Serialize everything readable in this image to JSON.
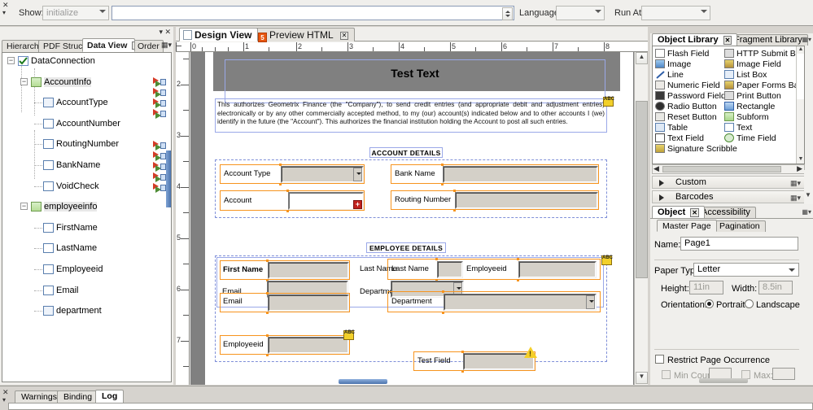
{
  "scriptbar": {
    "show_label": "Show:",
    "show_value": "initialize",
    "expression_value": "",
    "language_label": "Language:",
    "language_value": "",
    "runat_label": "Run At:",
    "runat_value": ""
  },
  "left_panel": {
    "tabs": [
      {
        "label": "Hierarch",
        "active": false
      },
      {
        "label": "PDF Structu",
        "active": false
      },
      {
        "label": "Data View",
        "active": true,
        "closable": true
      },
      {
        "label": "Order",
        "active": false
      }
    ],
    "tree": [
      {
        "label": "DataConnection",
        "level": 0,
        "icon": "data-connection-icon",
        "expander": "minus",
        "binding": false
      },
      {
        "label": "AccountInfo",
        "level": 1,
        "icon": "subform-group-icon",
        "expander": "minus",
        "binding": false
      },
      {
        "label": "AccountType",
        "level": 2,
        "icon": "list-field-icon",
        "expander": "none",
        "binding": true
      },
      {
        "label": "AccountNumber",
        "level": 2,
        "icon": "text-field-icon",
        "expander": "none",
        "binding": true
      },
      {
        "label": "RoutingNumber",
        "level": 2,
        "icon": "text-field-icon",
        "expander": "none",
        "binding": true
      },
      {
        "label": "BankName",
        "level": 2,
        "icon": "text-field-icon",
        "expander": "none",
        "binding": true
      },
      {
        "label": "VoidCheck",
        "level": 2,
        "icon": "text-field-icon",
        "expander": "none",
        "binding": false
      },
      {
        "label": "employeeinfo",
        "level": 1,
        "icon": "subform-group-icon",
        "expander": "minus",
        "binding": false
      },
      {
        "label": "FirstName",
        "level": 2,
        "icon": "text-field-icon",
        "expander": "none",
        "binding": true
      },
      {
        "label": "LastName",
        "level": 2,
        "icon": "text-field-icon",
        "expander": "none",
        "binding": true
      },
      {
        "label": "Employeeid",
        "level": 2,
        "icon": "text-field-icon",
        "expander": "none",
        "binding": true
      },
      {
        "label": "Email",
        "level": 2,
        "icon": "text-field-icon",
        "expander": "none",
        "binding": true
      },
      {
        "label": "department",
        "level": 2,
        "icon": "list-field-icon",
        "expander": "none",
        "binding": true
      }
    ]
  },
  "canvas": {
    "tabs": [
      {
        "label": "Design View",
        "icon": "page-icon",
        "active": true,
        "closable": false
      },
      {
        "label": "Preview HTML",
        "icon": "html5-icon",
        "active": false,
        "closable": true
      }
    ],
    "hruler_ticks": [
      "0",
      "1",
      "2",
      "3",
      "4",
      "5",
      "6",
      "7",
      "8"
    ],
    "vruler_ticks": [
      "2",
      "3",
      "4",
      "5",
      "6",
      "7"
    ],
    "form": {
      "header_title": "Test Text",
      "paragraph": "This authorizes Geometrix Finance (the \"Company\"), to send credit entries (and appropriate debit and adjustment entries) electronically or by any other commercially accepted method, to my (our) account(s) indicated below and to other accounts I (we) identify in the future (the \"Account\"). This authorizes the financial institution holding the Account to post all such entries.",
      "section_account": "ACCOUNT DETAILS",
      "section_employee": "EMPLOYEE DETAILS",
      "fields": {
        "account_type": "Account Type",
        "bank_name": "Bank Name",
        "account": "Account",
        "routing_number": "Routing Number",
        "first_name": "First Name",
        "last_name_label": "Last Name",
        "last_name_field": "Last Name",
        "employeeid_top": "Employeeid",
        "email_label": "Email",
        "department_label": "Department",
        "email_field": "Email",
        "department_field": "Department",
        "employeeid_bottom": "Employeeid",
        "test_field": "Test Field"
      }
    }
  },
  "object_library": {
    "tabs": [
      {
        "label": "Object Library",
        "active": true,
        "closable": true
      },
      {
        "label": "Fragment Library",
        "active": false
      }
    ],
    "items_left": [
      {
        "label": "Flash Field",
        "icon": "flash-field-icon"
      },
      {
        "label": "Image",
        "icon": "image-icon"
      },
      {
        "label": "Line",
        "icon": "line-icon"
      },
      {
        "label": "Numeric Field",
        "icon": "numeric-field-icon"
      },
      {
        "label": "Password Field",
        "icon": "password-field-icon"
      },
      {
        "label": "Radio Button",
        "icon": "radio-button-icon"
      },
      {
        "label": "Reset Button",
        "icon": "reset-button-icon"
      },
      {
        "label": "Table",
        "icon": "table-icon"
      },
      {
        "label": "Text Field",
        "icon": "text-field-icon"
      },
      {
        "label": "Signature Scribble",
        "icon": "signature-scribble-icon"
      }
    ],
    "items_right": [
      {
        "label": "HTTP Submit Butto",
        "icon": "http-submit-button-icon"
      },
      {
        "label": "Image Field",
        "icon": "image-field-icon"
      },
      {
        "label": "List Box",
        "icon": "list-box-icon"
      },
      {
        "label": "Paper Forms Barco",
        "icon": "paper-forms-barcode-icon"
      },
      {
        "label": "Print Button",
        "icon": "print-button-icon"
      },
      {
        "label": "Rectangle",
        "icon": "rectangle-icon"
      },
      {
        "label": "Subform",
        "icon": "subform-icon"
      },
      {
        "label": "Text",
        "icon": "text-icon"
      },
      {
        "label": "Time Field",
        "icon": "time-field-icon"
      }
    ],
    "sections": [
      {
        "label": "Custom"
      },
      {
        "label": "Barcodes"
      }
    ]
  },
  "object_panel": {
    "tabs": [
      {
        "label": "Object",
        "active": true,
        "closable": true
      },
      {
        "label": "Accessibility",
        "active": false
      }
    ],
    "subtabs": [
      {
        "label": "Master Page",
        "active": true
      },
      {
        "label": "Pagination",
        "active": false
      }
    ],
    "name_label": "Name:",
    "name_value": "Page1",
    "paper_type_label": "Paper Type:",
    "paper_type_value": "Letter",
    "height_label": "Height:",
    "height_value": "11in",
    "width_label": "Width:",
    "width_value": "8.5in",
    "orientation_label": "Orientation:",
    "orientation_portrait": "Portrait",
    "orientation_landscape": "Landscape",
    "orientation_selected": "Portrait",
    "restrict_label": "Restrict Page Occurrence",
    "restrict_checked": false,
    "min_count_label": "Min Count:",
    "min_count_value": "",
    "max_label": "Max:",
    "max_value": ""
  },
  "bottom": {
    "tabs": [
      {
        "label": "Warnings",
        "active": false
      },
      {
        "label": "Binding",
        "active": false
      },
      {
        "label": "Log",
        "active": true
      }
    ]
  },
  "colors": {
    "accent_orange": "#f7941e",
    "selection_blue": "#9aa8e8",
    "panel_bg": "#f0efec",
    "canvas_bg": "#808080",
    "warn_yellow": "#f5cf28"
  }
}
